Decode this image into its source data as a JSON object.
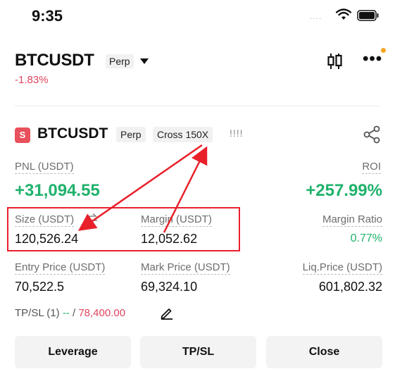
{
  "status_bar": {
    "time": "9:35",
    "signal_text": "....",
    "icons": [
      "wifi-icon",
      "battery-icon"
    ]
  },
  "header": {
    "symbol": "BTCUSDT",
    "contract_type": "Perp",
    "change": "-1.83%",
    "icons": [
      "chevron-down-icon",
      "candlestick-icon",
      "more-icon"
    ]
  },
  "position": {
    "side_badge": "S",
    "symbol": "BTCUSDT",
    "contract_type": "Perp",
    "margin_mode": "Cross 150X",
    "bars": "!!!!",
    "pnl_label": "PNL (USDT)",
    "pnl_value": "+31,094.55",
    "roi_label": "ROI",
    "roi_value": "+257.99%",
    "size_label": "Size (USDT)",
    "size_value": "120,526.24",
    "margin_label": "Margin (USDT)",
    "margin_value": "12,052.62",
    "margin_ratio_label": "Margin Ratio",
    "margin_ratio_value": "0.77%",
    "entry_label": "Entry Price (USDT)",
    "entry_value": "70,522.5",
    "mark_label": "Mark Price (USDT)",
    "mark_value": "69,324.10",
    "liq_label": "Liq.Price (USDT)",
    "liq_value": "601,802.32",
    "tpsl_prefix": "TP/SL (1)",
    "tpsl_tp": "--",
    "tpsl_sep": "/",
    "tpsl_sl": "78,400.00"
  },
  "buttons": {
    "leverage": "Leverage",
    "tpsl": "TP/SL",
    "close": "Close"
  },
  "colors": {
    "green": "#20b26c",
    "red": "#e0455e",
    "annotation_red": "#e8202a"
  }
}
